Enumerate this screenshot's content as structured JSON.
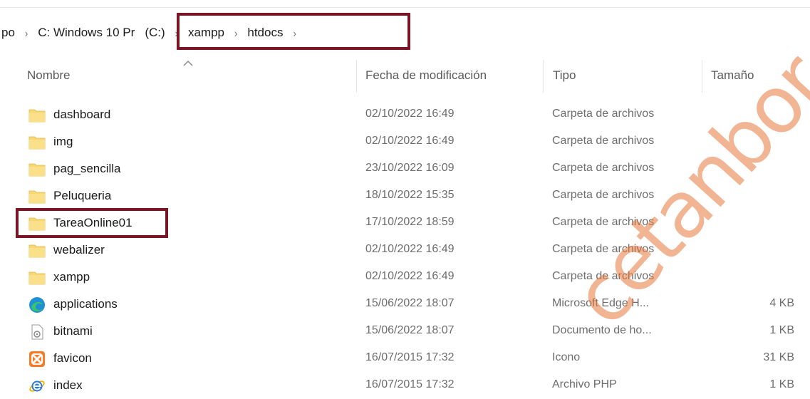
{
  "breadcrumb": {
    "items": [
      "po",
      "C: Windows 10 Pr",
      "(C:)",
      "xampp",
      "htdocs"
    ],
    "separator": ">"
  },
  "columns": {
    "name": "Nombre",
    "date": "Fecha de modificación",
    "type": "Tipo",
    "size": "Tamaño"
  },
  "files": [
    {
      "name": "dashboard",
      "date": "02/10/2022 16:49",
      "type": "Carpeta de archivos",
      "size": "",
      "icon": "folder-icon"
    },
    {
      "name": "img",
      "date": "02/10/2022 16:49",
      "type": "Carpeta de archivos",
      "size": "",
      "icon": "folder-icon"
    },
    {
      "name": "pag_sencilla",
      "date": "23/10/2022 16:09",
      "type": "Carpeta de archivos",
      "size": "",
      "icon": "folder-icon"
    },
    {
      "name": "Peluqueria",
      "date": "18/10/2022 15:35",
      "type": "Carpeta de archivos",
      "size": "",
      "icon": "folder-icon"
    },
    {
      "name": "TareaOnline01",
      "date": "17/10/2022 18:59",
      "type": "Carpeta de archivos",
      "size": "",
      "icon": "folder-icon"
    },
    {
      "name": "webalizer",
      "date": "02/10/2022 16:49",
      "type": "Carpeta de archivos",
      "size": "",
      "icon": "folder-icon"
    },
    {
      "name": "xampp",
      "date": "02/10/2022 16:49",
      "type": "Carpeta de archivos",
      "size": "",
      "icon": "folder-icon"
    },
    {
      "name": "applications",
      "date": "15/06/2022 18:07",
      "type": "Microsoft Edge H...",
      "size": "4 KB",
      "icon": "edge-icon"
    },
    {
      "name": "bitnami",
      "date": "15/06/2022 18:07",
      "type": "Documento de ho...",
      "size": "1 KB",
      "icon": "stylesheet-doc-icon"
    },
    {
      "name": "favicon",
      "date": "16/07/2015 17:32",
      "type": "Icono",
      "size": "31 KB",
      "icon": "xampp-favicon-icon"
    },
    {
      "name": "index",
      "date": "16/07/2015 17:32",
      "type": "Archivo PHP",
      "size": "1 KB",
      "icon": "ie-icon"
    }
  ],
  "watermark": "cetanbor",
  "colors": {
    "highlight": "#7a1526",
    "folder": "#f8d775",
    "watermark": "#e6783c"
  }
}
